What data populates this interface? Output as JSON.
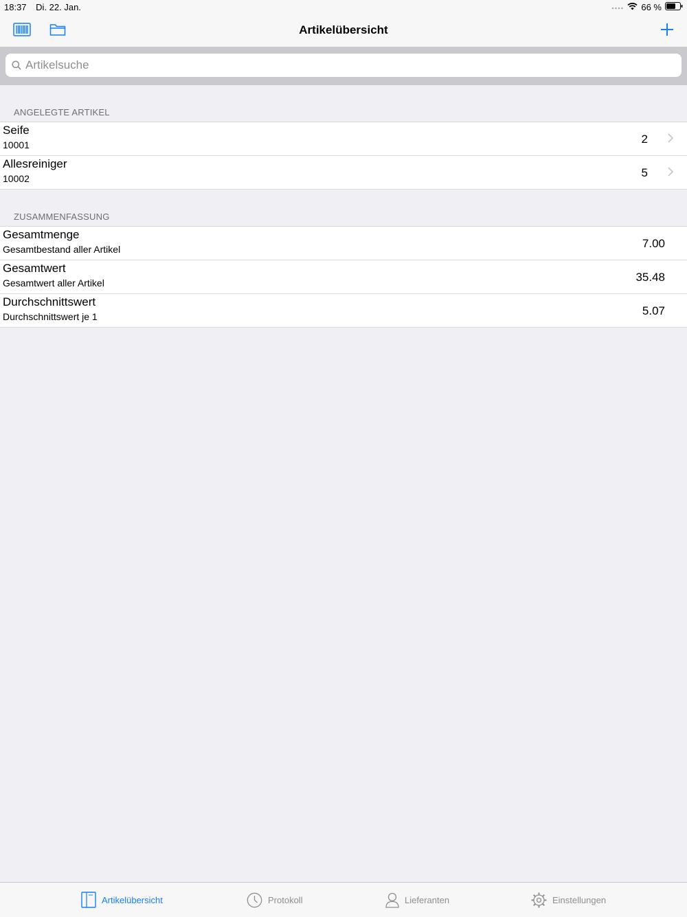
{
  "status": {
    "time": "18:37",
    "date": "Di. 22. Jan.",
    "battery": "66 %"
  },
  "nav": {
    "title": "Artikelübersicht"
  },
  "search": {
    "placeholder": "Artikelsuche"
  },
  "sections": {
    "items_header": "ANGELEGTE ARTIKEL",
    "summary_header": "ZUSAMMENFASSUNG"
  },
  "items": [
    {
      "name": "Seife",
      "number": "10001",
      "qty": "2"
    },
    {
      "name": "Allesreiniger",
      "number": "10002",
      "qty": "5"
    }
  ],
  "summary": [
    {
      "title": "Gesamtmenge",
      "subtitle": "Gesamtbestand aller Artikel",
      "value": "7.00"
    },
    {
      "title": "Gesamtwert",
      "subtitle": "Gesamtwert aller Artikel",
      "value": "35.48"
    },
    {
      "title": "Durchschnittswert",
      "subtitle": "Durchschnittswert je 1",
      "value": "5.07"
    }
  ],
  "tabs": [
    {
      "label": "Artikelübersicht",
      "icon": "book-icon",
      "active": true
    },
    {
      "label": "Protokoll",
      "icon": "clock-icon",
      "active": false
    },
    {
      "label": "Lieferanten",
      "icon": "person-icon",
      "active": false
    },
    {
      "label": "Einstellungen",
      "icon": "gear-icon",
      "active": false
    }
  ],
  "colors": {
    "accent": "#157efb",
    "background": "#efeff4",
    "bar": "#f7f7f7",
    "search_bg": "#c9c9ce"
  }
}
